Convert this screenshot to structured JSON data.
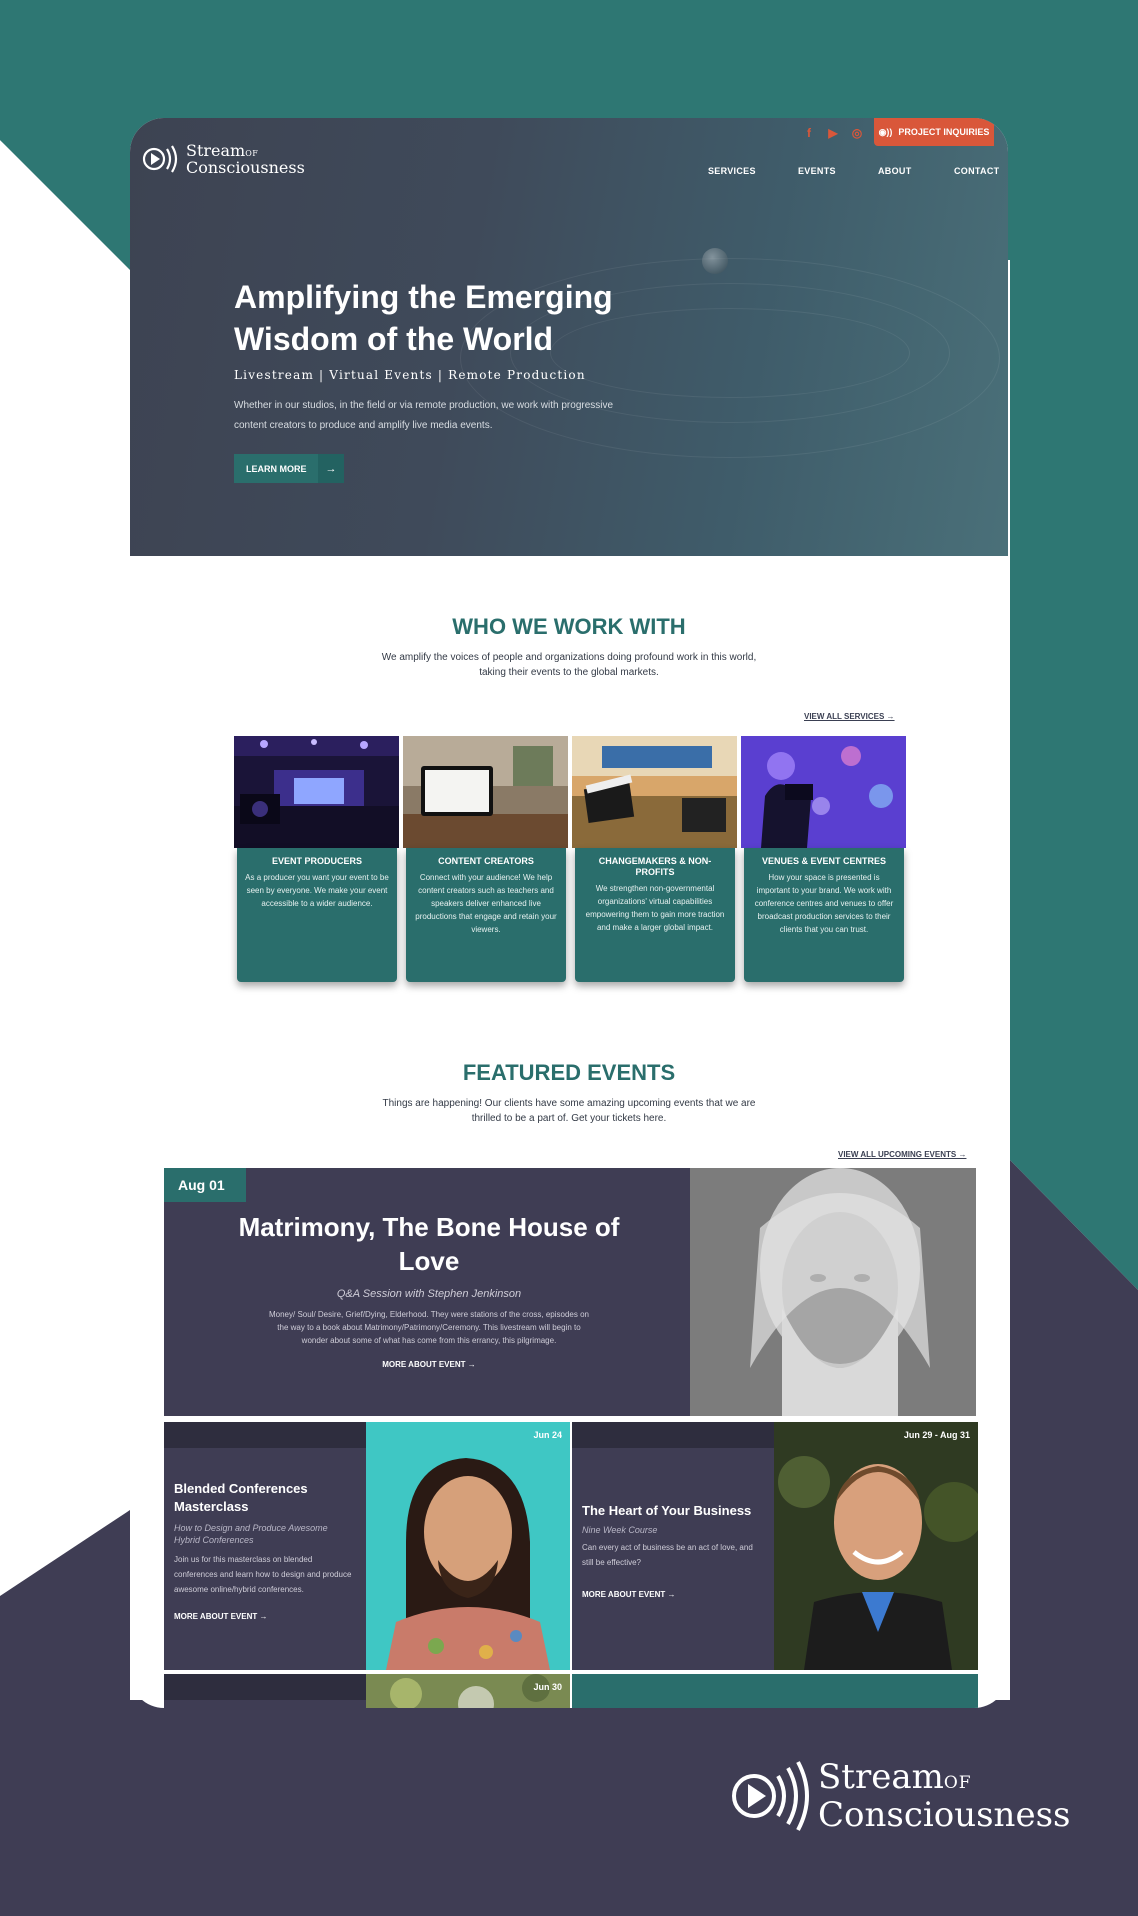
{
  "brand": {
    "logo_line1": "Stream",
    "logo_of": "OF",
    "logo_line2": "Consciousness",
    "colors": {
      "teal": "#2a6e6c",
      "dark_purple": "#3f3d54",
      "orange": "#d9573a"
    }
  },
  "header": {
    "social_icons": [
      "facebook-icon",
      "youtube-icon",
      "instagram-icon"
    ],
    "inquiries_button": "PROJECT INQUIRIES",
    "nav": [
      "SERVICES",
      "EVENTS",
      "ABOUT",
      "CONTACT"
    ]
  },
  "hero": {
    "title_line1": "Amplifying the Emerging",
    "title_line2": "Wisdom of the World",
    "subtitle": "Livestream | Virtual Events | Remote Production",
    "description": "Whether in our studios, in the field or via remote production, we work with progressive content creators to produce and amplify live media events.",
    "button_label": "LEARN MORE",
    "button_arrow": "→"
  },
  "who": {
    "title": "WHO WE WORK WITH",
    "description": "We amplify the voices of people and organizations doing profound work in this world, taking their events to the global markets.",
    "view_all": "VIEW ALL SERVICES →",
    "cards": [
      {
        "title": "EVENT PRODUCERS",
        "text": "As a producer you want your event to be seen by everyone. We make your event accessible to a wider audience."
      },
      {
        "title": "CONTENT CREATORS",
        "text": "Connect with your audience! We help content creators such as teachers and speakers deliver enhanced live productions that engage and retain your viewers."
      },
      {
        "title": "CHANGEMAKERS & NON-PROFITS",
        "text": "We strengthen non-governmental organizations' virtual capabilities empowering them to gain more traction and make a larger global impact."
      },
      {
        "title": "VENUES & EVENT CENTRES",
        "text": "How your space is presented is important to your brand. We work with conference centres and venues to offer broadcast production services to their clients that you can trust."
      }
    ]
  },
  "featured": {
    "title": "FEATURED EVENTS",
    "description": "Things are happening! Our clients have some amazing upcoming events that we are thrilled to be a part of. Get your tickets here.",
    "view_all": "VIEW ALL UPCOMING EVENTS →",
    "main_event": {
      "date": "Aug 01",
      "title": "Matrimony, The Bone House of Love",
      "subtitle": "Q&A Session with Stephen Jenkinson",
      "description": "Money/ Soul/ Desire, Grief/Dying, Elderhood. They were stations of the cross, episodes on the way to a book about Matrimony/Patrimony/Ceremony. This livestream will begin to wonder about some of what has come from this errancy, this pilgrimage.",
      "more": "MORE ABOUT EVENT →"
    },
    "events": [
      {
        "date": "Jun 24",
        "title": "Blended Conferences Masterclass",
        "subtitle": "How to Design and Produce Awesome Hybrid Conferences",
        "text": "Join us for this masterclass on blended conferences and learn how to design and produce awesome online/hybrid conferences.",
        "more": "MORE ABOUT EVENT →"
      },
      {
        "date": "Jun 29 - Aug 31",
        "title": "The Heart of Your Business",
        "subtitle": "Nine Week Course",
        "text": "Can every act of business be an act of love, and still be effective?",
        "more": "MORE ABOUT EVENT →"
      },
      {
        "date": "Jun 30"
      }
    ]
  },
  "footer": {
    "logo_line1": "Stream",
    "logo_of": "OF",
    "logo_line2": "Consciousness"
  }
}
